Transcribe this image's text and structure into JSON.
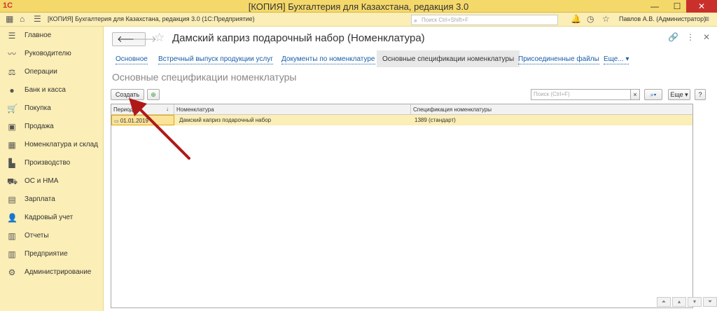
{
  "window": {
    "logo": "1С",
    "title": "[КОПИЯ] Бухгалтерия для Казахстана, редакция 3.0",
    "min": "—",
    "max": "☐",
    "close": "✕"
  },
  "header": {
    "app_name": "[КОПИЯ] Бухгалтерия для Казахстана, редакция 3.0  (1С:Предприятие)",
    "search_placeholder": "Поиск Ctrl+Shift+F",
    "user": "Павлов А.В. (Администратор)"
  },
  "sidebar": {
    "items": [
      {
        "label": "Главное",
        "icon": "☰"
      },
      {
        "label": "Руководителю",
        "icon": "〰"
      },
      {
        "label": "Операции",
        "icon": "⚖"
      },
      {
        "label": "Банк и касса",
        "icon": "●"
      },
      {
        "label": "Покупка",
        "icon": "🛒"
      },
      {
        "label": "Продажа",
        "icon": "▣"
      },
      {
        "label": "Номенклатура и склад",
        "icon": "▦"
      },
      {
        "label": "Производство",
        "icon": "▙"
      },
      {
        "label": "ОС и НМА",
        "icon": "⛟"
      },
      {
        "label": "Зарплата",
        "icon": "▤"
      },
      {
        "label": "Кадровый учет",
        "icon": "👤"
      },
      {
        "label": "Отчеты",
        "icon": "▥"
      },
      {
        "label": "Предприятие",
        "icon": "▥"
      },
      {
        "label": "Администрирование",
        "icon": "⚙"
      }
    ]
  },
  "main": {
    "title": "Дамский каприз подарочный набор (Номенклатура)",
    "tabs": [
      {
        "label": "Основное"
      },
      {
        "label": "Встречный выпуск продукции услуг"
      },
      {
        "label": "Документы по номенклатуре"
      },
      {
        "label": "Основные спецификации номенклатуры"
      },
      {
        "label": "Присоединенные файлы"
      },
      {
        "label": "Еще... ▾"
      }
    ],
    "subtitle": "Основные спецификации номенклатуры",
    "toolbar": {
      "create_label": "Создать",
      "search_placeholder": "Поиск (Ctrl+F)",
      "clear": "×",
      "more_label": "Еще ▾",
      "help": "?"
    },
    "table": {
      "columns": [
        "Период",
        "Номенклатура",
        "Спецификация номенклатуры"
      ],
      "sort_indicator": "↓",
      "rows": [
        {
          "period": "01.01.2019",
          "item": "Дамский каприз подарочный набор",
          "spec": "1389 (стандарт)"
        }
      ]
    }
  }
}
